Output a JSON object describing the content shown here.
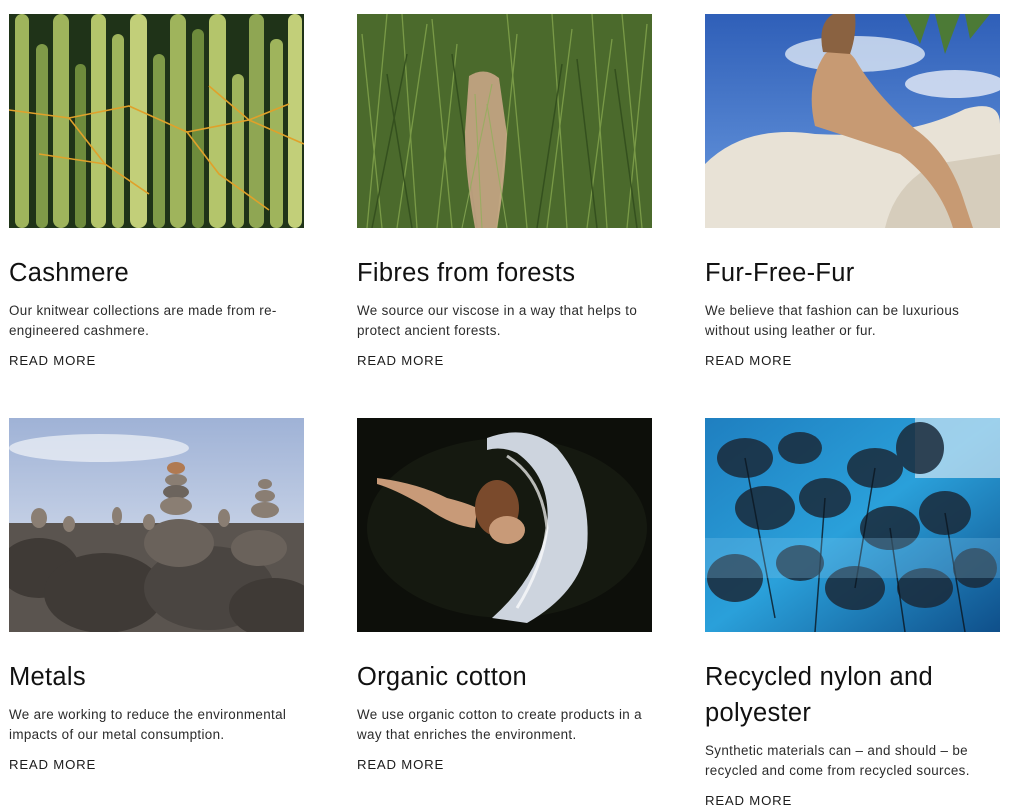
{
  "cards": [
    {
      "title": "Cashmere",
      "description": "Our knitwear collections are made from re-engineered cashmere.",
      "link": "READ MORE"
    },
    {
      "title": "Fibres from forests",
      "description": "We source our viscose in a way that helps to protect ancient forests.",
      "link": "READ MORE"
    },
    {
      "title": "Fur-Free-Fur",
      "description": "We believe that fashion can be luxurious without using leather or fur.",
      "link": "READ MORE"
    },
    {
      "title": "Metals",
      "description": "We are working to reduce the environmental impacts of our metal consumption.",
      "link": "READ MORE"
    },
    {
      "title": "Organic cotton",
      "description": "We use organic cotton to create products in a way that enriches the environment.",
      "link": "READ MORE"
    },
    {
      "title": "Recycled nylon and polyester",
      "description": "Synthetic materials can – and should – be recycled and come from recycled sources.",
      "link": "READ MORE"
    }
  ]
}
